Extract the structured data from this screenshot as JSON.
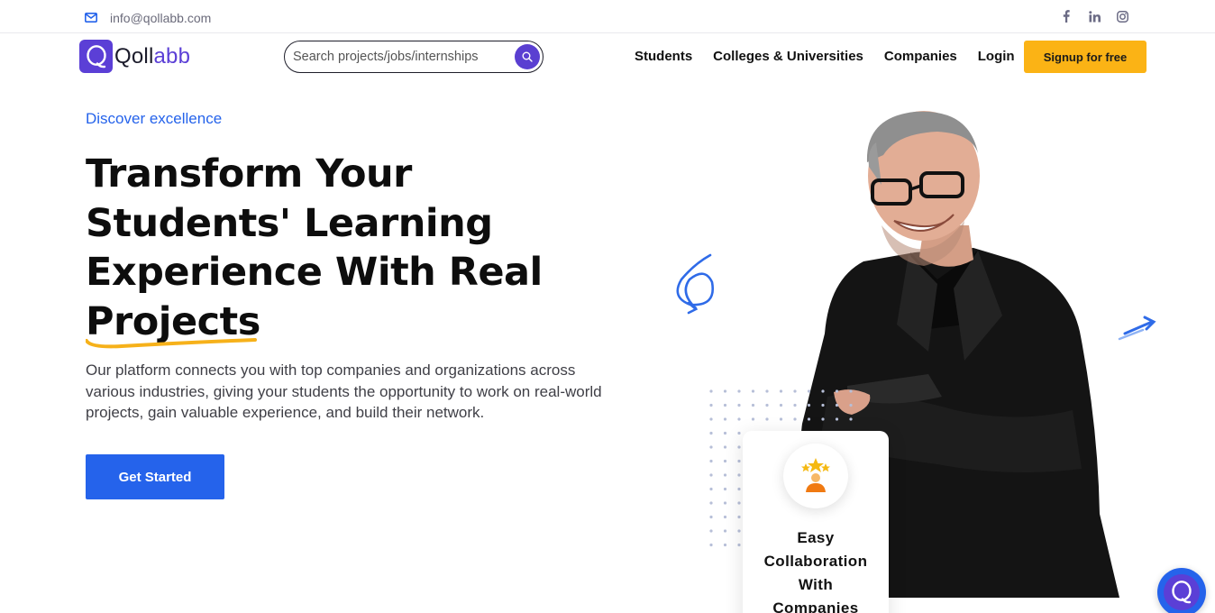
{
  "topbar": {
    "email": "info@qollabb.com",
    "email_icon": "mail-icon",
    "social": [
      "facebook-icon",
      "linkedin-icon",
      "instagram-icon"
    ]
  },
  "brand": {
    "name_part1": "Qoll",
    "name_part2": "abb",
    "color": "#5b3fd6"
  },
  "search": {
    "placeholder": "Search projects/jobs/internships",
    "icon": "search-icon"
  },
  "nav": {
    "items": [
      "Students",
      "Colleges & Universities",
      "Companies",
      "Login"
    ],
    "signup_label": "Signup for free",
    "signup_color": "#fbb315"
  },
  "hero": {
    "eyebrow": "Discover excellence",
    "headline_line1": "Transform Your",
    "headline_line2": "Students' Learning",
    "headline_line3": "Experience With Real",
    "headline_line4": "Projects",
    "lead": "Our platform connects you with top companies and organizations across various industries, giving your students the opportunity to work on real-world projects, gain valuable experience, and build their network.",
    "cta_label": "Get Started",
    "accent": "#2563eb"
  },
  "feature_card": {
    "line1": "Easy",
    "line2": "Collaboration",
    "line3": "With",
    "line4": "Companies",
    "icon": "star-achievement-icon"
  },
  "chat_widget": {
    "icon": "chat-logo-icon"
  }
}
